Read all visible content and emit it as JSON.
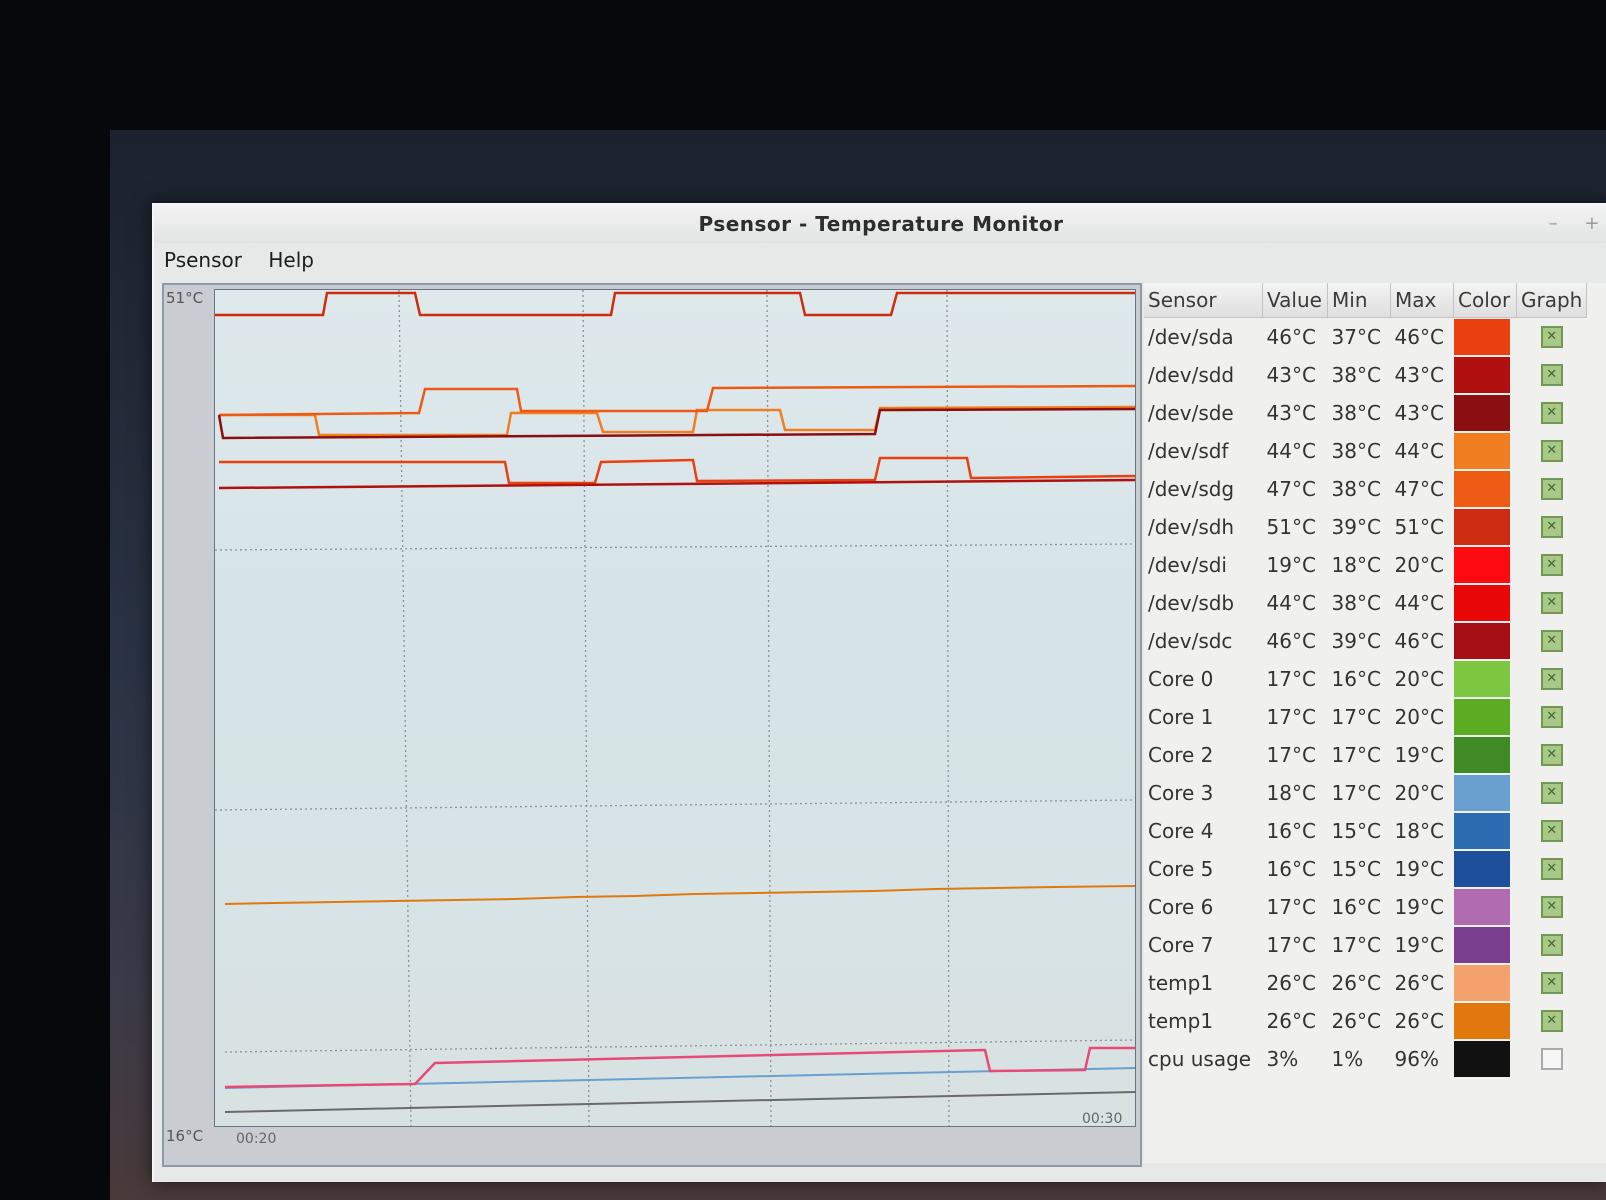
{
  "window": {
    "title": "Psensor - Temperature Monitor",
    "minimize": "–",
    "maximize": "+"
  },
  "menu": {
    "psensor": "Psensor",
    "help": "Help"
  },
  "graph": {
    "y_max": "51°C",
    "y_min": "16°C",
    "x_start": "00:20",
    "x_end": "00:30"
  },
  "table": {
    "headers": {
      "sensor": "Sensor",
      "value": "Value",
      "min": "Min",
      "max": "Max",
      "color": "Color",
      "graph": "Graph"
    },
    "rows": [
      {
        "sensor": "/dev/sda",
        "value": "46°C",
        "min": "37°C",
        "max": "46°C",
        "color": "#e8400f",
        "graph": true
      },
      {
        "sensor": "/dev/sdd",
        "value": "43°C",
        "min": "38°C",
        "max": "43°C",
        "color": "#b01010",
        "graph": true
      },
      {
        "sensor": "/dev/sde",
        "value": "43°C",
        "min": "38°C",
        "max": "43°C",
        "color": "#8a0f10",
        "graph": true
      },
      {
        "sensor": "/dev/sdf",
        "value": "44°C",
        "min": "38°C",
        "max": "44°C",
        "color": "#f07d20",
        "graph": true
      },
      {
        "sensor": "/dev/sdg",
        "value": "47°C",
        "min": "38°C",
        "max": "47°C",
        "color": "#ee5a14",
        "graph": true
      },
      {
        "sensor": "/dev/sdh",
        "value": "51°C",
        "min": "39°C",
        "max": "51°C",
        "color": "#cc2d10",
        "graph": true
      },
      {
        "sensor": "/dev/sdi",
        "value": "19°C",
        "min": "18°C",
        "max": "20°C",
        "color": "#ff0a10",
        "graph": true
      },
      {
        "sensor": "/dev/sdb",
        "value": "44°C",
        "min": "38°C",
        "max": "44°C",
        "color": "#e80808",
        "graph": true
      },
      {
        "sensor": "/dev/sdc",
        "value": "46°C",
        "min": "39°C",
        "max": "46°C",
        "color": "#a50e14",
        "graph": true
      },
      {
        "sensor": "Core 0",
        "value": "17°C",
        "min": "16°C",
        "max": "20°C",
        "color": "#7cc640",
        "graph": true
      },
      {
        "sensor": "Core 1",
        "value": "17°C",
        "min": "17°C",
        "max": "20°C",
        "color": "#5bab23",
        "graph": true
      },
      {
        "sensor": "Core 2",
        "value": "17°C",
        "min": "17°C",
        "max": "19°C",
        "color": "#3f8a24",
        "graph": true
      },
      {
        "sensor": "Core 3",
        "value": "18°C",
        "min": "17°C",
        "max": "20°C",
        "color": "#6aa0cf",
        "graph": true
      },
      {
        "sensor": "Core 4",
        "value": "16°C",
        "min": "15°C",
        "max": "18°C",
        "color": "#2e6cb2",
        "graph": true
      },
      {
        "sensor": "Core 5",
        "value": "16°C",
        "min": "15°C",
        "max": "19°C",
        "color": "#1e4f9b",
        "graph": true
      },
      {
        "sensor": "Core 6",
        "value": "17°C",
        "min": "16°C",
        "max": "19°C",
        "color": "#b06cb0",
        "graph": true
      },
      {
        "sensor": "Core 7",
        "value": "17°C",
        "min": "17°C",
        "max": "19°C",
        "color": "#7a3e8e",
        "graph": true
      },
      {
        "sensor": "temp1",
        "value": "26°C",
        "min": "26°C",
        "max": "26°C",
        "color": "#f2a26a",
        "graph": true
      },
      {
        "sensor": "temp1",
        "value": "26°C",
        "min": "26°C",
        "max": "26°C",
        "color": "#e0780e",
        "graph": true
      },
      {
        "sensor": "cpu usage",
        "value": "3%",
        "min": "1%",
        "max": "96%",
        "color": "#111111",
        "graph": false
      }
    ]
  }
}
